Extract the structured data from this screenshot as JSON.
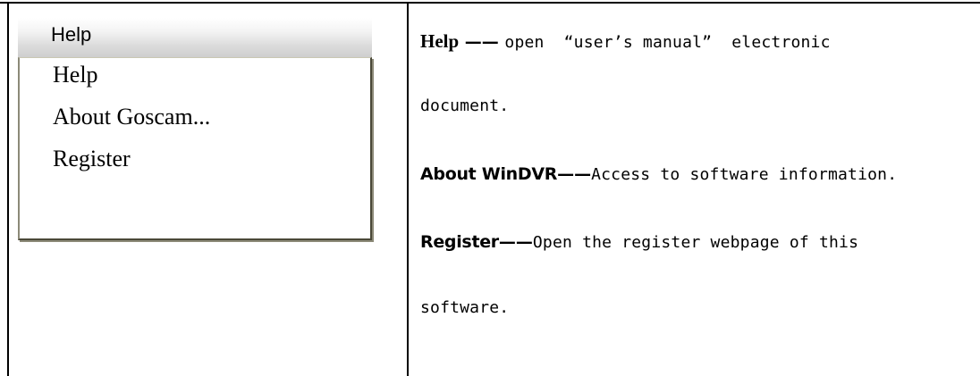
{
  "menu": {
    "bar_label": "Help",
    "items": [
      {
        "label": "Help"
      },
      {
        "label": "About Goscam..."
      },
      {
        "label": "Register"
      }
    ]
  },
  "description": {
    "help": {
      "term": "Help",
      "dash": " —— ",
      "text_line1": "open  “user’s manual”  electronic",
      "text_line2": "document."
    },
    "about": {
      "term": "About WinDVR",
      "dash": "——",
      "text": "Access to software information."
    },
    "register": {
      "term": "Register",
      "dash": "——",
      "text_line1": "Open the register webpage of this",
      "text_line2": "software."
    }
  }
}
